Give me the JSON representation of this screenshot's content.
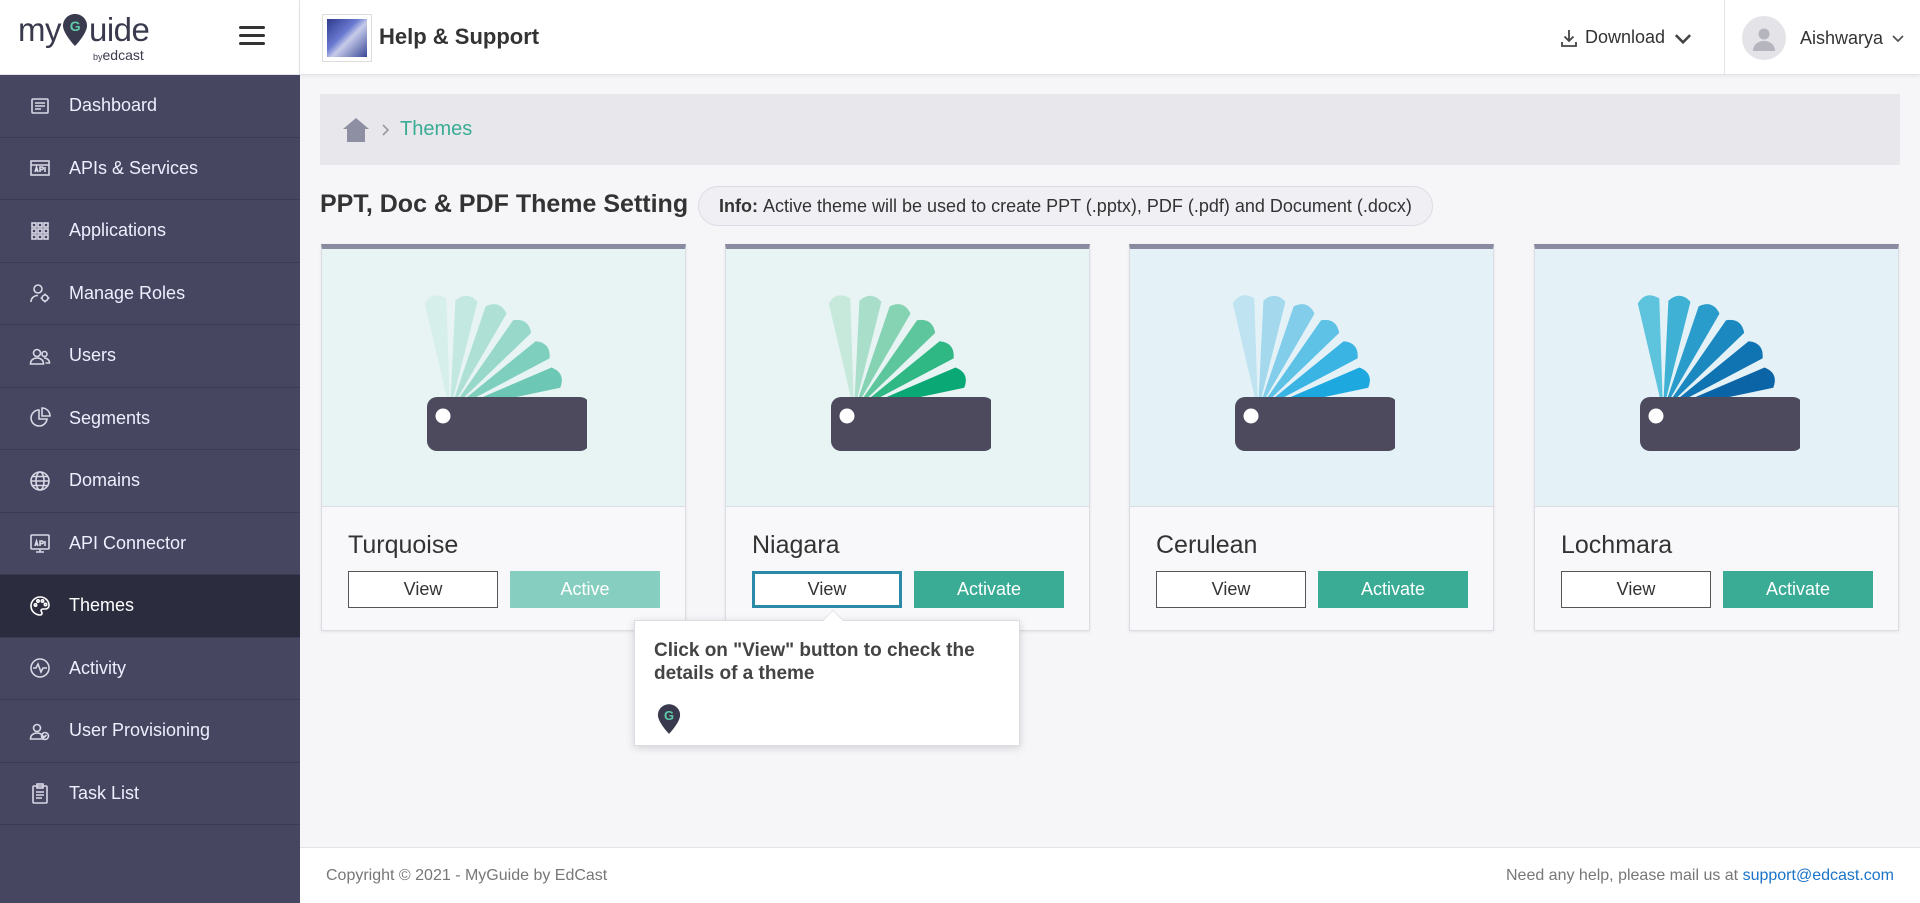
{
  "brand": {
    "name_before": "my",
    "name_after": "uide",
    "by": "by",
    "sub": "edcast"
  },
  "sidebar": {
    "items": [
      {
        "label": "Dashboard",
        "icon": "dashboard-icon"
      },
      {
        "label": "APIs & Services",
        "icon": "api-icon"
      },
      {
        "label": "Applications",
        "icon": "grid-icon"
      },
      {
        "label": "Manage Roles",
        "icon": "roles-icon"
      },
      {
        "label": "Users",
        "icon": "users-icon"
      },
      {
        "label": "Segments",
        "icon": "pie-icon"
      },
      {
        "label": "Domains",
        "icon": "globe-icon"
      },
      {
        "label": "API Connector",
        "icon": "api-connector-icon"
      },
      {
        "label": "Themes",
        "icon": "palette-icon",
        "active": true
      },
      {
        "label": "Activity",
        "icon": "activity-icon"
      },
      {
        "label": "User Provisioning",
        "icon": "user-provisioning-icon"
      },
      {
        "label": "Task List",
        "icon": "clipboard-icon"
      }
    ]
  },
  "header": {
    "app_title": "Help & Support",
    "download_label": "Download",
    "user_name": "Aishwarya"
  },
  "breadcrumb": {
    "current": "Themes"
  },
  "page": {
    "title": "PPT, Doc & PDF Theme Setting",
    "info_label": "Info:",
    "info_text": "Active theme will be used to create PPT (.pptx), PDF (.pdf) and Document (.docx)"
  },
  "themes": [
    {
      "name": "Turquoise",
      "view_label": "View",
      "action_label": "Active",
      "bg": "#e8f4f3",
      "colors": [
        "#d6efea",
        "#c3e8e1",
        "#aee0d6",
        "#98d8cb",
        "#7fcfbf",
        "#6cc8b5"
      ]
    },
    {
      "name": "Niagara",
      "view_label": "View",
      "action_label": "Activate",
      "bg": "#e8f4f3",
      "colors": [
        "#c7e9dc",
        "#a9dfca",
        "#86d3b4",
        "#5ec69c",
        "#2fb784",
        "#0aa874"
      ]
    },
    {
      "name": "Cerulean",
      "view_label": "View",
      "action_label": "Activate",
      "bg": "#e4f2f8",
      "colors": [
        "#bfe3f0",
        "#a4d9ed",
        "#82cde9",
        "#5ec1e6",
        "#3ab4e3",
        "#1ea8e0"
      ]
    },
    {
      "name": "Lochmara",
      "view_label": "View",
      "action_label": "Activate",
      "bg": "#e4f2f8",
      "colors": [
        "#5ec3dc",
        "#3fb1d4",
        "#2a9ccb",
        "#1b88bf",
        "#1174b2",
        "#0b64a5"
      ]
    }
  ],
  "tooltip": {
    "text": "Click on \"View\" button to check the details of a theme"
  },
  "footer": {
    "copyright": "Copyright © 2021 - MyGuide by EdCast",
    "help_text": "Need any help, please mail us at",
    "email": "support@edcast.com"
  },
  "colors": {
    "sidebar_bg": "#464660",
    "sidebar_active": "#2c2c3f",
    "accent": "#3aac95",
    "palette_dark": "#4d4a5e"
  }
}
